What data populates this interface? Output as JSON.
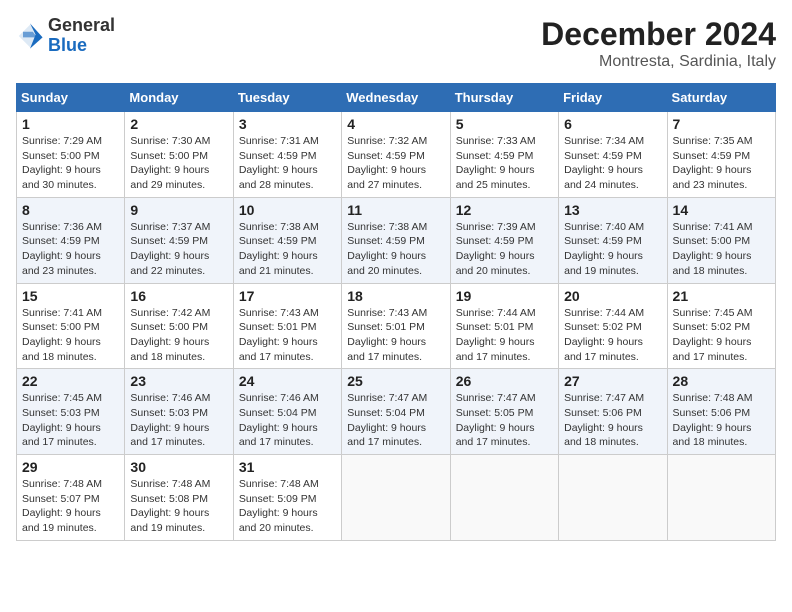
{
  "header": {
    "logo_general": "General",
    "logo_blue": "Blue",
    "month_title": "December 2024",
    "location": "Montresta, Sardinia, Italy"
  },
  "days_of_week": [
    "Sunday",
    "Monday",
    "Tuesday",
    "Wednesday",
    "Thursday",
    "Friday",
    "Saturday"
  ],
  "weeks": [
    [
      {
        "day": "1",
        "sunrise": "Sunrise: 7:29 AM",
        "sunset": "Sunset: 5:00 PM",
        "daylight": "Daylight: 9 hours and 30 minutes."
      },
      {
        "day": "2",
        "sunrise": "Sunrise: 7:30 AM",
        "sunset": "Sunset: 5:00 PM",
        "daylight": "Daylight: 9 hours and 29 minutes."
      },
      {
        "day": "3",
        "sunrise": "Sunrise: 7:31 AM",
        "sunset": "Sunset: 4:59 PM",
        "daylight": "Daylight: 9 hours and 28 minutes."
      },
      {
        "day": "4",
        "sunrise": "Sunrise: 7:32 AM",
        "sunset": "Sunset: 4:59 PM",
        "daylight": "Daylight: 9 hours and 27 minutes."
      },
      {
        "day": "5",
        "sunrise": "Sunrise: 7:33 AM",
        "sunset": "Sunset: 4:59 PM",
        "daylight": "Daylight: 9 hours and 25 minutes."
      },
      {
        "day": "6",
        "sunrise": "Sunrise: 7:34 AM",
        "sunset": "Sunset: 4:59 PM",
        "daylight": "Daylight: 9 hours and 24 minutes."
      },
      {
        "day": "7",
        "sunrise": "Sunrise: 7:35 AM",
        "sunset": "Sunset: 4:59 PM",
        "daylight": "Daylight: 9 hours and 23 minutes."
      }
    ],
    [
      {
        "day": "8",
        "sunrise": "Sunrise: 7:36 AM",
        "sunset": "Sunset: 4:59 PM",
        "daylight": "Daylight: 9 hours and 23 minutes."
      },
      {
        "day": "9",
        "sunrise": "Sunrise: 7:37 AM",
        "sunset": "Sunset: 4:59 PM",
        "daylight": "Daylight: 9 hours and 22 minutes."
      },
      {
        "day": "10",
        "sunrise": "Sunrise: 7:38 AM",
        "sunset": "Sunset: 4:59 PM",
        "daylight": "Daylight: 9 hours and 21 minutes."
      },
      {
        "day": "11",
        "sunrise": "Sunrise: 7:38 AM",
        "sunset": "Sunset: 4:59 PM",
        "daylight": "Daylight: 9 hours and 20 minutes."
      },
      {
        "day": "12",
        "sunrise": "Sunrise: 7:39 AM",
        "sunset": "Sunset: 4:59 PM",
        "daylight": "Daylight: 9 hours and 20 minutes."
      },
      {
        "day": "13",
        "sunrise": "Sunrise: 7:40 AM",
        "sunset": "Sunset: 4:59 PM",
        "daylight": "Daylight: 9 hours and 19 minutes."
      },
      {
        "day": "14",
        "sunrise": "Sunrise: 7:41 AM",
        "sunset": "Sunset: 5:00 PM",
        "daylight": "Daylight: 9 hours and 18 minutes."
      }
    ],
    [
      {
        "day": "15",
        "sunrise": "Sunrise: 7:41 AM",
        "sunset": "Sunset: 5:00 PM",
        "daylight": "Daylight: 9 hours and 18 minutes."
      },
      {
        "day": "16",
        "sunrise": "Sunrise: 7:42 AM",
        "sunset": "Sunset: 5:00 PM",
        "daylight": "Daylight: 9 hours and 18 minutes."
      },
      {
        "day": "17",
        "sunrise": "Sunrise: 7:43 AM",
        "sunset": "Sunset: 5:01 PM",
        "daylight": "Daylight: 9 hours and 17 minutes."
      },
      {
        "day": "18",
        "sunrise": "Sunrise: 7:43 AM",
        "sunset": "Sunset: 5:01 PM",
        "daylight": "Daylight: 9 hours and 17 minutes."
      },
      {
        "day": "19",
        "sunrise": "Sunrise: 7:44 AM",
        "sunset": "Sunset: 5:01 PM",
        "daylight": "Daylight: 9 hours and 17 minutes."
      },
      {
        "day": "20",
        "sunrise": "Sunrise: 7:44 AM",
        "sunset": "Sunset: 5:02 PM",
        "daylight": "Daylight: 9 hours and 17 minutes."
      },
      {
        "day": "21",
        "sunrise": "Sunrise: 7:45 AM",
        "sunset": "Sunset: 5:02 PM",
        "daylight": "Daylight: 9 hours and 17 minutes."
      }
    ],
    [
      {
        "day": "22",
        "sunrise": "Sunrise: 7:45 AM",
        "sunset": "Sunset: 5:03 PM",
        "daylight": "Daylight: 9 hours and 17 minutes."
      },
      {
        "day": "23",
        "sunrise": "Sunrise: 7:46 AM",
        "sunset": "Sunset: 5:03 PM",
        "daylight": "Daylight: 9 hours and 17 minutes."
      },
      {
        "day": "24",
        "sunrise": "Sunrise: 7:46 AM",
        "sunset": "Sunset: 5:04 PM",
        "daylight": "Daylight: 9 hours and 17 minutes."
      },
      {
        "day": "25",
        "sunrise": "Sunrise: 7:47 AM",
        "sunset": "Sunset: 5:04 PM",
        "daylight": "Daylight: 9 hours and 17 minutes."
      },
      {
        "day": "26",
        "sunrise": "Sunrise: 7:47 AM",
        "sunset": "Sunset: 5:05 PM",
        "daylight": "Daylight: 9 hours and 17 minutes."
      },
      {
        "day": "27",
        "sunrise": "Sunrise: 7:47 AM",
        "sunset": "Sunset: 5:06 PM",
        "daylight": "Daylight: 9 hours and 18 minutes."
      },
      {
        "day": "28",
        "sunrise": "Sunrise: 7:48 AM",
        "sunset": "Sunset: 5:06 PM",
        "daylight": "Daylight: 9 hours and 18 minutes."
      }
    ],
    [
      {
        "day": "29",
        "sunrise": "Sunrise: 7:48 AM",
        "sunset": "Sunset: 5:07 PM",
        "daylight": "Daylight: 9 hours and 19 minutes."
      },
      {
        "day": "30",
        "sunrise": "Sunrise: 7:48 AM",
        "sunset": "Sunset: 5:08 PM",
        "daylight": "Daylight: 9 hours and 19 minutes."
      },
      {
        "day": "31",
        "sunrise": "Sunrise: 7:48 AM",
        "sunset": "Sunset: 5:09 PM",
        "daylight": "Daylight: 9 hours and 20 minutes."
      },
      null,
      null,
      null,
      null
    ]
  ]
}
